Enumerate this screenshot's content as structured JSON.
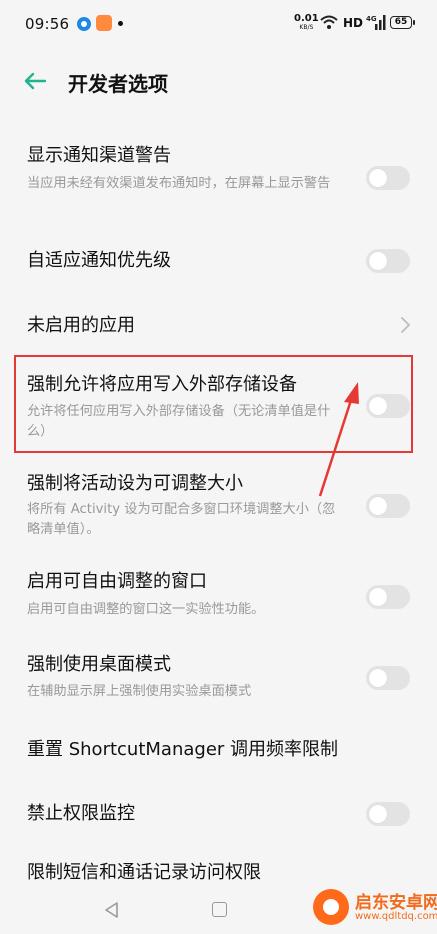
{
  "status_bar": {
    "time": "09:56",
    "net_speed_value": "0.01",
    "net_speed_unit": "KB/S",
    "hd": "HD",
    "battery": "65"
  },
  "header": {
    "title": "开发者选项",
    "back_icon": "arrow-left-icon",
    "accent": "#20b38c"
  },
  "settings": [
    {
      "title": "显示通知渠道警告",
      "subtitle": "当应用未经有效渠道发布通知时，在屏幕上显示警告",
      "control": "toggle",
      "on": false
    },
    {
      "title": "自适应通知优先级",
      "subtitle": "",
      "control": "toggle",
      "on": false
    },
    {
      "title": "未启用的应用",
      "subtitle": "",
      "control": "chevron"
    },
    {
      "title": "强制允许将应用写入外部存储设备",
      "subtitle": "允许将任何应用写入外部存储设备（无论清单值是什么）",
      "control": "toggle",
      "on": false
    },
    {
      "title": "强制将活动设为可调整大小",
      "subtitle": "将所有 Activity 设为可配合多窗口环境调整大小（忽略清单值）。",
      "control": "toggle",
      "on": false
    },
    {
      "title": "启用可自由调整的窗口",
      "subtitle": "启用可自由调整的窗口这一实验性功能。",
      "control": "toggle",
      "on": false
    },
    {
      "title": "强制使用桌面模式",
      "subtitle": "在辅助显示屏上强制使用实验桌面模式",
      "control": "toggle",
      "on": false
    },
    {
      "title": "重置 ShortcutManager 调用频率限制",
      "subtitle": "",
      "control": "none"
    },
    {
      "title": "禁止权限监控",
      "subtitle": "",
      "control": "toggle",
      "on": false
    },
    {
      "title": "限制短信和通话记录访问权限",
      "subtitle": "",
      "control": "none"
    }
  ],
  "annotation": {
    "highlight_color": "#e53935"
  },
  "watermark": {
    "name": "启东安卓网",
    "url": "www.qdltdq.com"
  }
}
